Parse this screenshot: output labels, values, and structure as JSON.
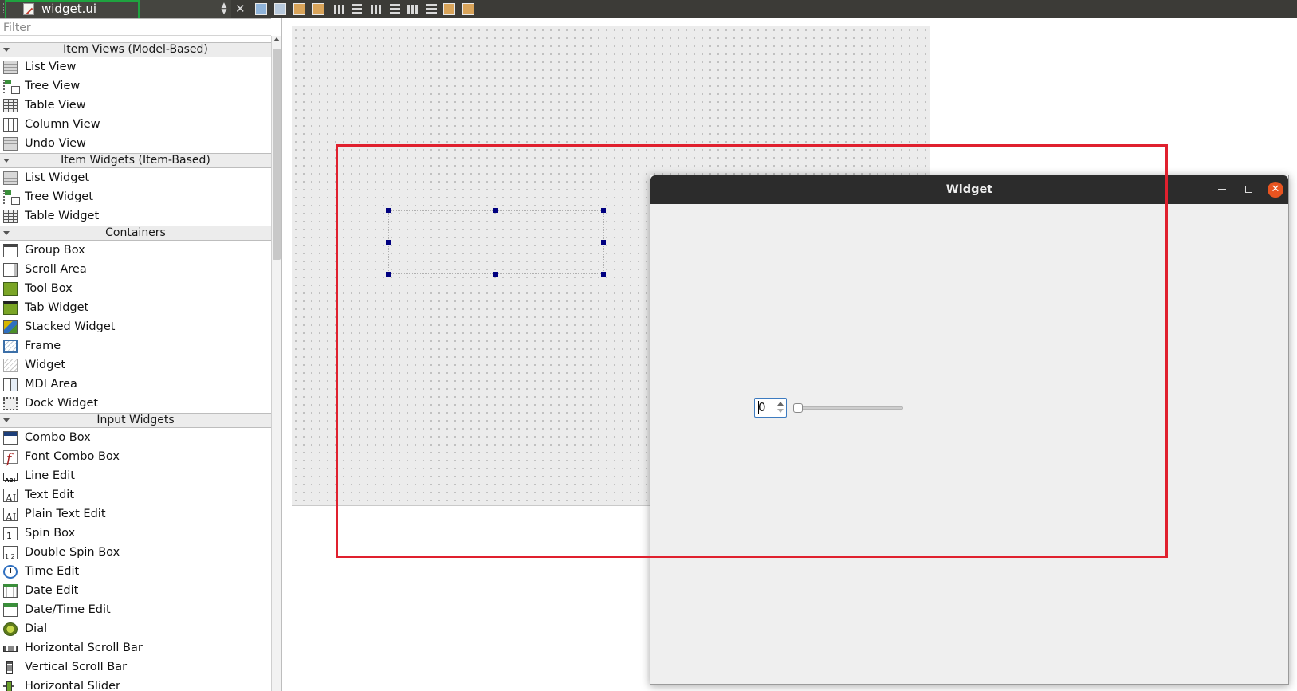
{
  "toolbar": {
    "file_name": "widget.ui",
    "file_arrows": "▲\n▼",
    "close_glyph": "✕",
    "icons": [
      "edit-widgets-icon",
      "edit-signals-slots-icon",
      "edit-buddies-icon",
      "edit-tab-order-icon",
      "layout-horizontal-icon",
      "layout-vertical-icon",
      "layout-horizontal-splitter-icon",
      "layout-vertical-splitter-icon",
      "layout-form-icon",
      "layout-grid-icon",
      "break-layout-icon",
      "adjust-size-icon"
    ]
  },
  "widget_box": {
    "filter_placeholder": "Filter",
    "categories": [
      {
        "title": "Item Views (Model-Based)",
        "items": [
          {
            "label": "List View",
            "icon": "list"
          },
          {
            "label": "Tree View",
            "icon": "tree"
          },
          {
            "label": "Table View",
            "icon": "table"
          },
          {
            "label": "Column View",
            "icon": "column"
          },
          {
            "label": "Undo View",
            "icon": "list"
          }
        ]
      },
      {
        "title": "Item Widgets (Item-Based)",
        "items": [
          {
            "label": "List Widget",
            "icon": "list"
          },
          {
            "label": "Tree Widget",
            "icon": "tree"
          },
          {
            "label": "Table Widget",
            "icon": "table"
          }
        ]
      },
      {
        "title": "Containers",
        "items": [
          {
            "label": "Group Box",
            "icon": "group"
          },
          {
            "label": "Scroll Area",
            "icon": "scroll"
          },
          {
            "label": "Tool Box",
            "icon": "toolbox"
          },
          {
            "label": "Tab Widget",
            "icon": "tab"
          },
          {
            "label": "Stacked Widget",
            "icon": "stacked"
          },
          {
            "label": "Frame",
            "icon": "frame"
          },
          {
            "label": "Widget",
            "icon": "widget"
          },
          {
            "label": "MDI Area",
            "icon": "mdi"
          },
          {
            "label": "Dock Widget",
            "icon": "dock"
          }
        ]
      },
      {
        "title": "Input Widgets",
        "items": [
          {
            "label": "Combo Box",
            "icon": "combo"
          },
          {
            "label": "Font Combo Box",
            "icon": "font"
          },
          {
            "label": "Line Edit",
            "icon": "lineedit"
          },
          {
            "label": "Text Edit",
            "icon": "textedit"
          },
          {
            "label": "Plain Text Edit",
            "icon": "textedit"
          },
          {
            "label": "Spin Box",
            "icon": "spin"
          },
          {
            "label": "Double Spin Box",
            "icon": "dspin"
          },
          {
            "label": "Time Edit",
            "icon": "time"
          },
          {
            "label": "Date Edit",
            "icon": "date"
          },
          {
            "label": "Date/Time Edit",
            "icon": "datetime"
          },
          {
            "label": "Dial",
            "icon": "dial"
          },
          {
            "label": "Horizontal Scroll Bar",
            "icon": "hscroll"
          },
          {
            "label": "Vertical Scroll Bar",
            "icon": "vscroll"
          },
          {
            "label": "Horizontal Slider",
            "icon": "hslider"
          }
        ]
      }
    ]
  },
  "preview_window": {
    "title": "Widget",
    "close_glyph": "✕",
    "spin_value": "0",
    "slider_value": 0
  },
  "colors": {
    "accent_close": "#e95420",
    "highlight_red": "#e0202e",
    "highlight_green": "#1fa340",
    "selection_handle": "#000080"
  }
}
